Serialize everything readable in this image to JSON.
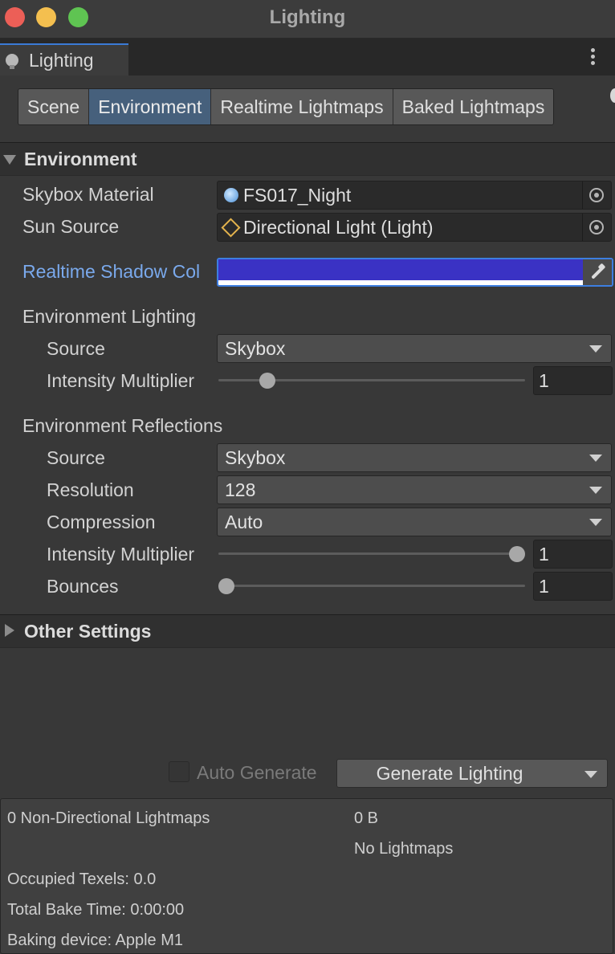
{
  "window": {
    "title": "Lighting"
  },
  "panel_tab": {
    "label": "Lighting"
  },
  "tabs": [
    {
      "label": "Scene",
      "active": false
    },
    {
      "label": "Environment",
      "active": true
    },
    {
      "label": "Realtime Lightmaps",
      "active": false
    },
    {
      "label": "Baked Lightmaps",
      "active": false
    }
  ],
  "environment": {
    "header": "Environment",
    "skybox_material": {
      "label": "Skybox Material",
      "value": "FS017_Night",
      "icon": "skybox-icon"
    },
    "sun_source": {
      "label": "Sun Source",
      "value": "Directional Light (Light)",
      "icon": "directional-light-icon"
    },
    "shadow_color": {
      "label": "Realtime Shadow Col",
      "color": "#3a32c4"
    },
    "lighting": {
      "label": "Environment Lighting",
      "source": {
        "label": "Source",
        "value": "Skybox"
      },
      "intensity": {
        "label": "Intensity Multiplier",
        "value": "1",
        "slider_fraction": 0.14
      }
    },
    "reflections": {
      "label": "Environment Reflections",
      "source": {
        "label": "Source",
        "value": "Skybox"
      },
      "resolution": {
        "label": "Resolution",
        "value": "128"
      },
      "compression": {
        "label": "Compression",
        "value": "Auto"
      },
      "intensity": {
        "label": "Intensity Multiplier",
        "value": "1",
        "slider_fraction": 1.0
      },
      "bounces": {
        "label": "Bounces",
        "value": "1",
        "slider_fraction": 0.0
      }
    }
  },
  "other_settings": {
    "header": "Other Settings"
  },
  "footer": {
    "auto_generate": {
      "label": "Auto Generate",
      "checked": false
    },
    "generate_button": "Generate Lighting"
  },
  "stats": {
    "lightmaps": "0 Non-Directional Lightmaps",
    "size": "0 B",
    "no_lightmaps": "No Lightmaps",
    "occupied_texels": "Occupied Texels: 0.0",
    "bake_time": "Total Bake Time: 0:00:00",
    "device": "Baking device: Apple M1"
  },
  "colors": {
    "accent": "#3a7ad6",
    "active_tab": "#46607c",
    "label_highlight": "#7aa9ec"
  }
}
